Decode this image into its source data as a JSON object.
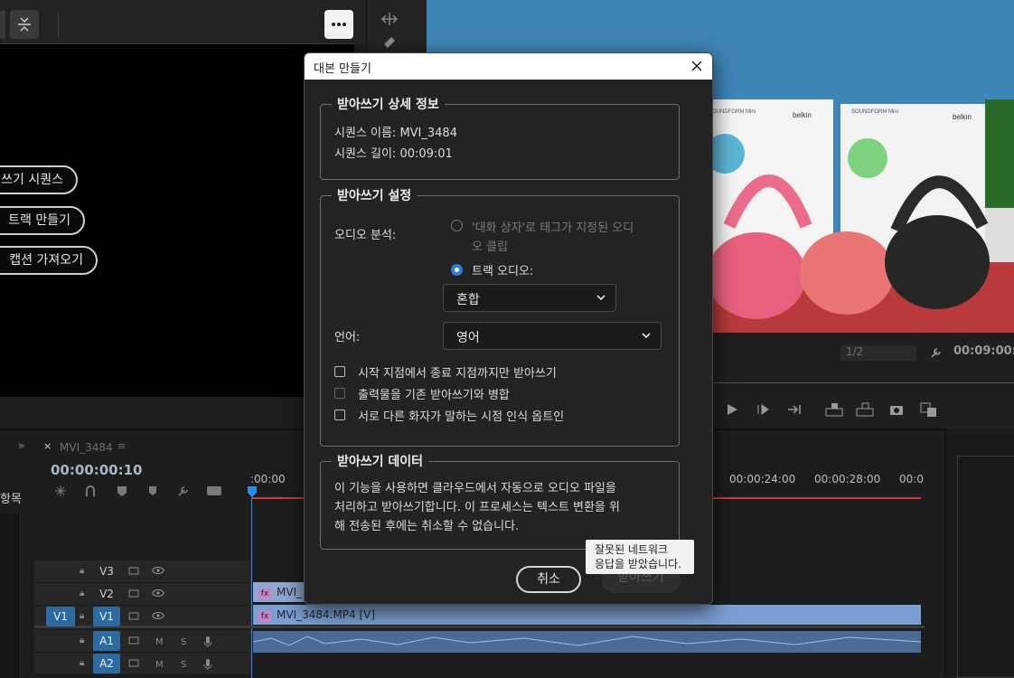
{
  "source_monitor": {
    "buttons": [
      "쓰기 시퀀스",
      "트랙 만들기",
      "캡션 가져오기"
    ]
  },
  "program_monitor": {
    "zoom": "1/2",
    "timecode": "00:09:00:0",
    "product_brand": "belkin",
    "product_name": "SOUNDFORM Mini"
  },
  "timeline": {
    "tab": "MVI_3484",
    "timecode": "00:00:00:10",
    "side_label": "항목",
    "ruler": [
      ":00:00",
      "00:00:24:00",
      "00:00:28:00",
      "00:0"
    ],
    "video_tracks": [
      "V3",
      "V2",
      "V1"
    ],
    "audio_tracks": [
      "A1",
      "A2"
    ],
    "source_patch": "V1",
    "track_flags": {
      "mute": "M",
      "solo": "S"
    },
    "clips": {
      "v2": "MVI_",
      "v1": "MVI_3484.MP4 [V]",
      "fx": "fx"
    }
  },
  "dialog": {
    "title": "대본 만들기",
    "details": {
      "legend": "받아쓰기 상세 정보",
      "sequence_name": "시퀀스 이름: MVI_3484",
      "sequence_length": "시퀀스 길이: 00:09:01"
    },
    "settings": {
      "legend": "받아쓰기 설정",
      "audio_analysis_label": "오디오 분석:",
      "radio_dialogue_line1": "'대화 상자'로 태그가 지정된 오디",
      "radio_dialogue_line2": "오 클립",
      "radio_track": "트랙 오디오:",
      "mix_value": "혼합",
      "language_label": "언어:",
      "language_value": "영어",
      "checkbox_inout": "시작 지점에서 종료 지점까지만 받아쓰기",
      "checkbox_merge": "출력물을 기존 받아쓰기와 병합",
      "checkbox_speaker": "서로 다른 화자가 말하는 시점 인식 옵트인"
    },
    "data": {
      "legend": "받아쓰기 데이터",
      "line1": "이 기능을 사용하면 클라우드에서 자동으로 오디오 파일을",
      "line2": "처리하고 받아쓰기합니다. 이 프로세스는 텍스트 변환을 위",
      "line3": "해 전송된 후에는 취소할 수 없습니다."
    },
    "cancel_label": "취소",
    "transcribe_label": "받아쓰기"
  },
  "tooltip": {
    "line1": "잘못된 네트워크",
    "line2": "응답을 받았습니다."
  },
  "colors": {
    "accent": "#2f7fd6",
    "playhead": "#2d8cf0",
    "ruler_red": "#d33a3a",
    "track_active": "#2d6a9f",
    "clip_video": "#7b9fd1",
    "clip_pink": "#c784c7"
  }
}
